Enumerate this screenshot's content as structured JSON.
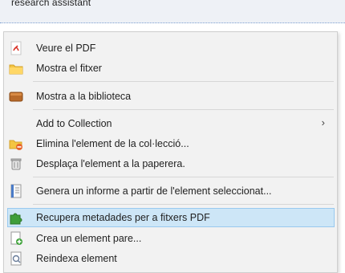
{
  "header": {
    "fragment": "research assistant"
  },
  "menu": {
    "items": [
      {
        "label": "Veure el PDF",
        "icon": "pdf-icon"
      },
      {
        "label": "Mostra el fitxer",
        "icon": "folder-icon"
      },
      {
        "label": "Mostra a la biblioteca",
        "icon": "library-icon"
      },
      {
        "label": "Add to Collection",
        "icon": "",
        "submenu": "›"
      },
      {
        "label": "Elimina l'element de la col·lecció...",
        "icon": "remove-from-collection-icon"
      },
      {
        "label": "Desplaça l'element a la paperera.",
        "icon": "trash-icon"
      },
      {
        "label": "Genera un informe a partir de l'element seleccionat...",
        "icon": "report-icon"
      },
      {
        "label": "Recupera metadades per a fitxers PDF",
        "icon": "puzzle-icon",
        "highlighted": true
      },
      {
        "label": "Crea un element pare...",
        "icon": "new-parent-icon"
      },
      {
        "label": "Reindexa element",
        "icon": "reindex-icon"
      }
    ]
  },
  "colors": {
    "menu_bg": "#f2f2f2",
    "highlight_bg": "#cde6f7",
    "highlight_border": "#99c9ef",
    "header_bg": "#eef1f6"
  }
}
